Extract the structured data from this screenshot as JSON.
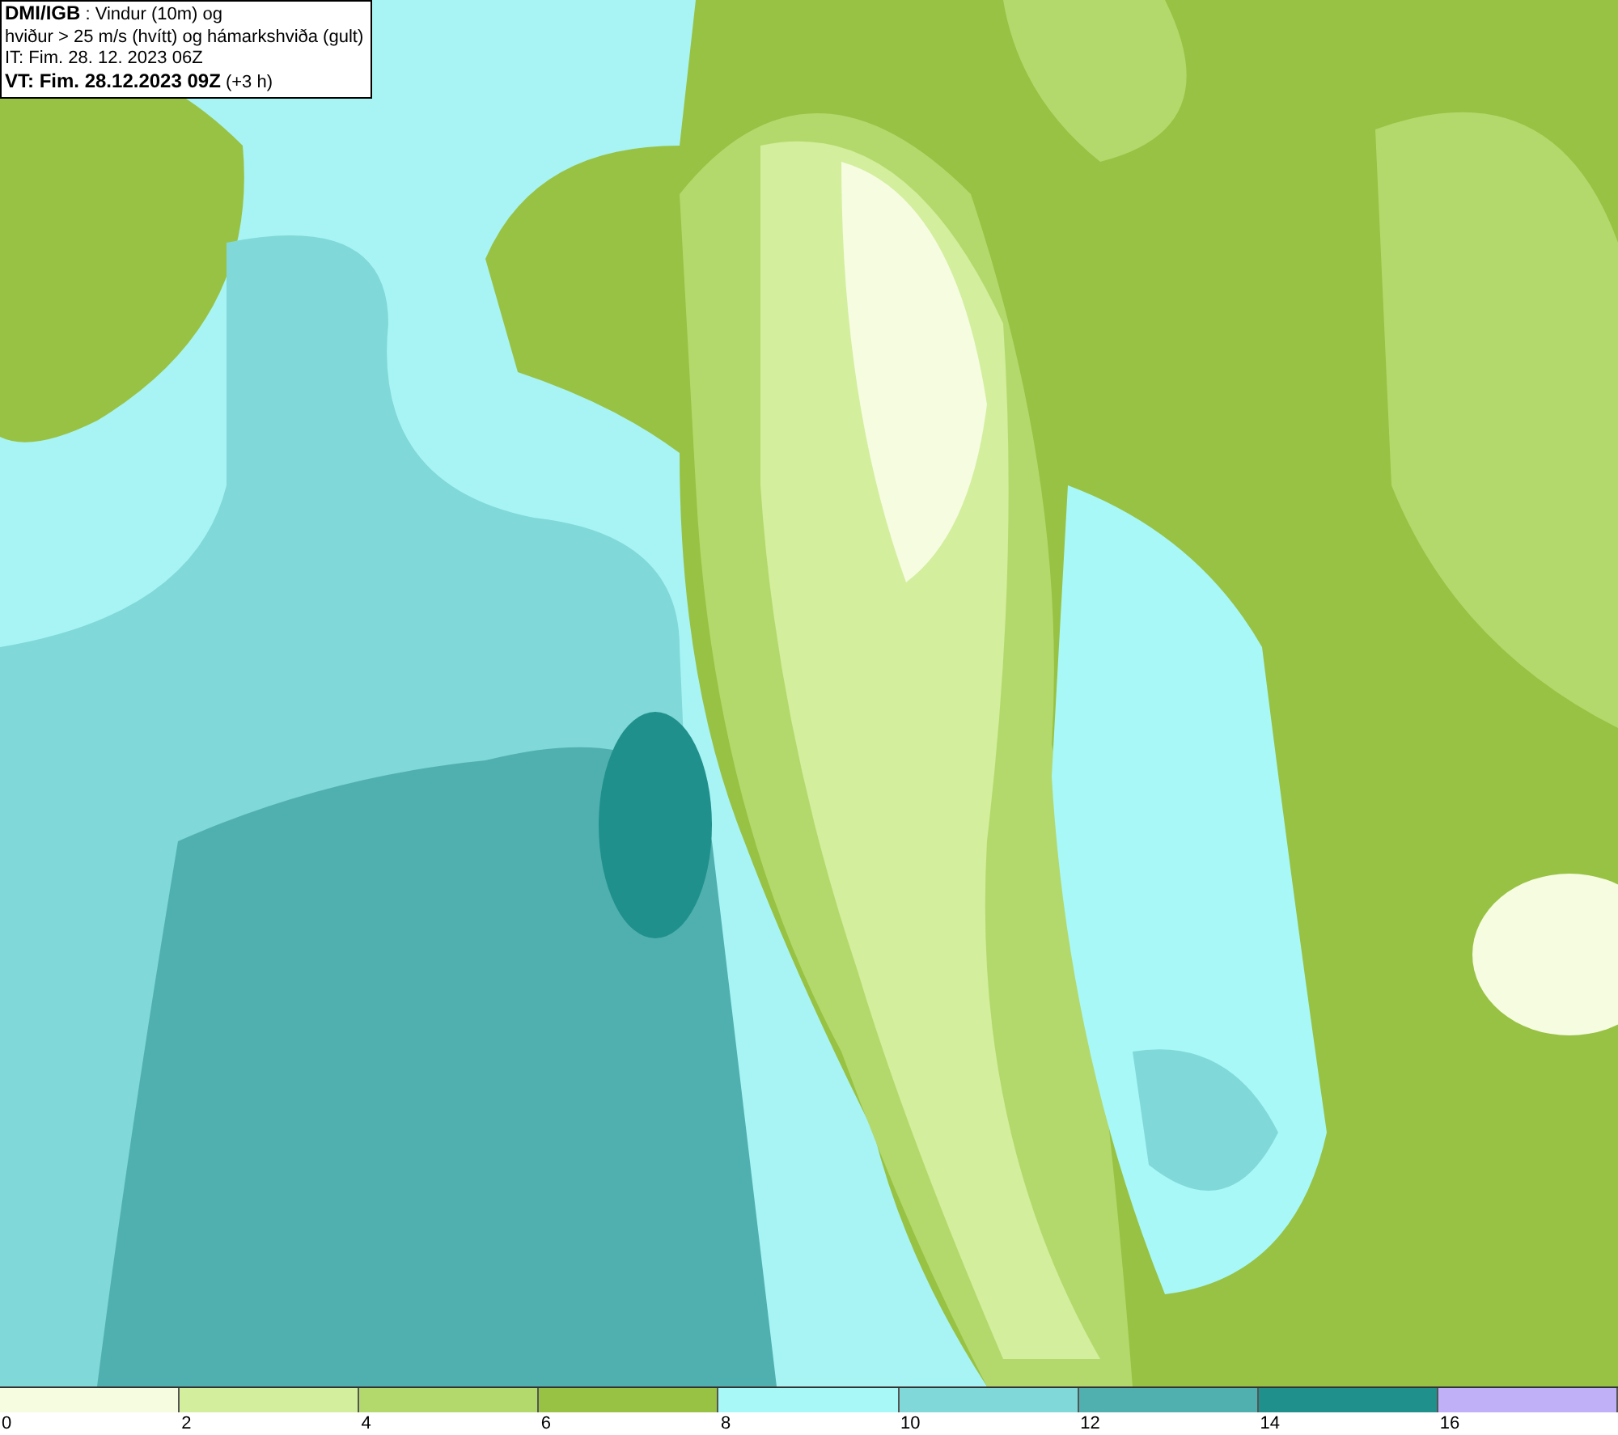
{
  "info_box": {
    "lines": [
      "**DMI/IGB** : Vindur (10m) og",
      "hviður > 25 m/s (hvítt) og hámarkshviða (gult)",
      "IT: Fim. 28. 12. 2023 06Z",
      "**VT: Fim. 28.12.2023 09Z** (+3 h)"
    ]
  },
  "legend": {
    "bins": [
      {
        "color": "#f5fce0"
      },
      {
        "color": "#d3ee9c"
      },
      {
        "color": "#b3d96c"
      },
      {
        "color": "#98c243"
      },
      {
        "color": "#a8f8f8"
      },
      {
        "color": "#80d8d8"
      },
      {
        "color": "#50b0b0"
      },
      {
        "color": "#20908c"
      },
      {
        "color": "#c0b0f8"
      }
    ],
    "ticks": [
      "0",
      "2",
      "4",
      "6",
      "8",
      "10",
      "12",
      "14",
      "16"
    ]
  }
}
